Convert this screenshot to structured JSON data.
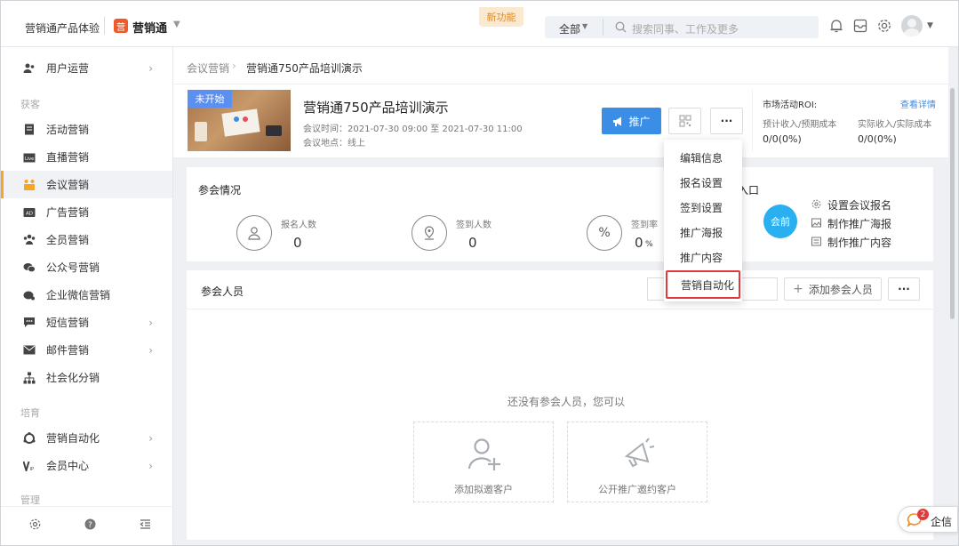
{
  "header": {
    "product_name": "营销通产品体验",
    "app_name": "营销通",
    "new_feature_badge": "新功能",
    "scope_select": "全部",
    "search_placeholder": "搜索同事、工作及更多"
  },
  "sidebar": {
    "top_item": "用户运营",
    "section_acquire": "获客",
    "items_acquire": [
      "活动营销",
      "直播营销",
      "会议营销",
      "广告营销",
      "全员营销",
      "公众号营销",
      "企业微信营销",
      "短信营销",
      "邮件营销",
      "社会化分销"
    ],
    "section_nurture": "培育",
    "items_nurture": [
      "营销自动化",
      "会员中心"
    ],
    "section_manage": "管理"
  },
  "breadcrumb": {
    "parent": "会议营销",
    "current": "营销通750产品培训演示"
  },
  "event": {
    "status": "未开始",
    "title": "营销通750产品培训演示",
    "time_label": "会议时间：2021-07-30 09:00 至 2021-07-30 11:00",
    "location_label": "会议地点：线上",
    "promote_button": "推广",
    "more_button": "···"
  },
  "roi": {
    "title": "市场活动ROI:",
    "detail_link": "查看详情",
    "expected_label": "预计收入/预期成本",
    "expected_value": "0/0(0%)",
    "actual_label": "实际收入/实际成本",
    "actual_value": "0/0(0%)"
  },
  "attendance": {
    "title": "参会情况",
    "stats": [
      {
        "label": "报名人数",
        "value": "0"
      },
      {
        "label": "签到人数",
        "value": "0"
      },
      {
        "label": "签到率",
        "value": "0",
        "unit": "%"
      }
    ],
    "entry_title_partial": "入口",
    "entry_badge": "会前",
    "entry_links": [
      "设置会议报名",
      "制作推广海报",
      "制作推广内容"
    ]
  },
  "participants": {
    "title": "参会人员",
    "add_button": "添加参会人员",
    "more_button": "···",
    "empty_text": "还没有参会人员，您可以",
    "actions": [
      "添加拟邀客户",
      "公开推广邀约客户"
    ]
  },
  "dropdown": {
    "items": [
      "编辑信息",
      "报名设置",
      "签到设置",
      "推广海报",
      "推广内容",
      "营销自动化"
    ],
    "highlighted": "营销自动化"
  },
  "chat_widget": {
    "label": "企信",
    "badge": "2"
  },
  "colors": {
    "accent_blue": "#3a8ee6",
    "badge_orange": "#f5a623",
    "highlight_red": "#e4393c",
    "entry_badge": "#2aaff0"
  }
}
